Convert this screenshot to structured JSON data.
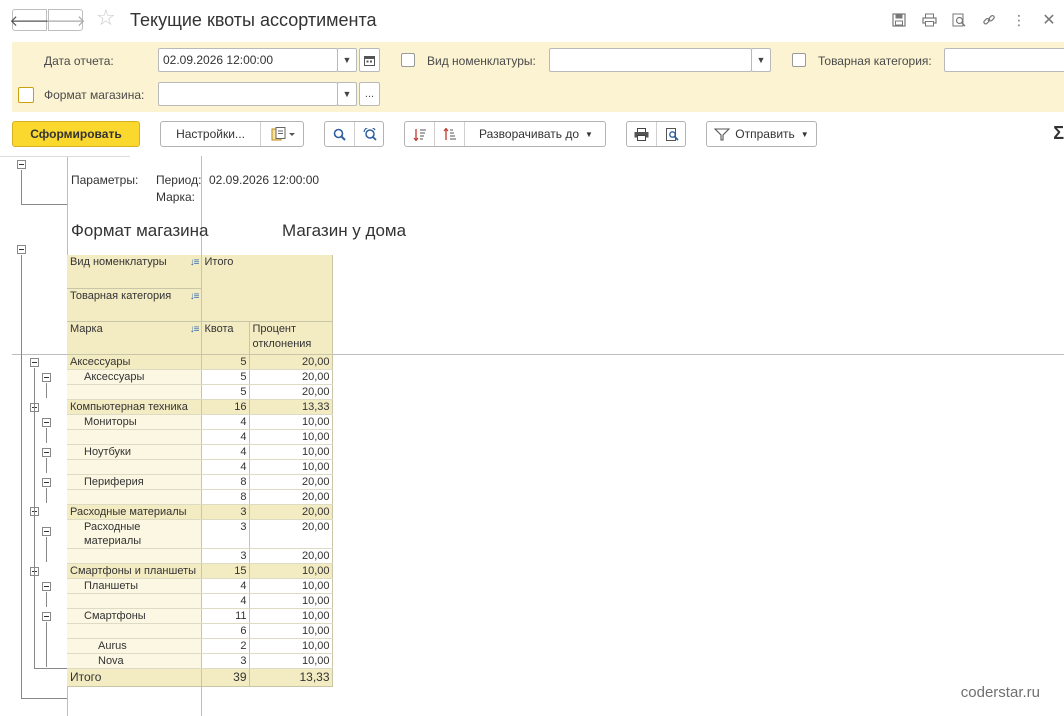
{
  "window": {
    "title": "Текущие квоты ассортимента"
  },
  "filters": {
    "report_date_label": "Дата отчета:",
    "report_date_value": "02.09.2026 12:00:00",
    "nomenclature_type_label": "Вид номенклатуры:",
    "nomenclature_type_value": "",
    "product_category_label": "Товарная категория:",
    "product_category_value": "",
    "store_format_label": "Формат магазина:",
    "store_format_value": ""
  },
  "toolbar": {
    "generate_label": "Сформировать",
    "settings_label": "Настройки...",
    "expand_label": "Разворачивать до",
    "send_label": "Отправить",
    "sigma_label": "Σ"
  },
  "report": {
    "params_label": "Параметры:",
    "period_label": "Период:",
    "period_value": "02.09.2026 12:00:00",
    "brand_param_label": "Марка:",
    "group_label": "Формат магазина",
    "group_value": "Магазин у дома",
    "headers": {
      "nomenclature_type": "Вид номенклатуры",
      "product_category": "Товарная категория",
      "brand": "Марка",
      "total": "Итого",
      "quota": "Квота",
      "deviation": "Процент отклонения"
    },
    "rows": [
      {
        "label": "Аксессуары",
        "level": 0,
        "quota": "5",
        "deviation": "20,00"
      },
      {
        "label": "Аксессуары",
        "level": 1,
        "quota": "5",
        "deviation": "20,00"
      },
      {
        "label": "",
        "level": 2,
        "quota": "5",
        "deviation": "20,00"
      },
      {
        "label": "Компьютерная техника",
        "level": 0,
        "quota": "16",
        "deviation": "13,33"
      },
      {
        "label": "Мониторы",
        "level": 1,
        "quota": "4",
        "deviation": "10,00"
      },
      {
        "label": "",
        "level": 2,
        "quota": "4",
        "deviation": "10,00"
      },
      {
        "label": "Ноутбуки",
        "level": 1,
        "quota": "4",
        "deviation": "10,00"
      },
      {
        "label": "",
        "level": 2,
        "quota": "4",
        "deviation": "10,00"
      },
      {
        "label": "Периферия",
        "level": 1,
        "quota": "8",
        "deviation": "20,00"
      },
      {
        "label": "",
        "level": 2,
        "quota": "8",
        "deviation": "20,00"
      },
      {
        "label": "Расходные материалы",
        "level": 0,
        "quota": "3",
        "deviation": "20,00"
      },
      {
        "label": "Расходные материалы",
        "level": 1,
        "quota": "3",
        "deviation": "20,00"
      },
      {
        "label": "",
        "level": 2,
        "quota": "3",
        "deviation": "20,00"
      },
      {
        "label": "Смартфоны и планшеты",
        "level": 0,
        "quota": "15",
        "deviation": "10,00"
      },
      {
        "label": "Планшеты",
        "level": 1,
        "quota": "4",
        "deviation": "10,00"
      },
      {
        "label": "",
        "level": 2,
        "quota": "4",
        "deviation": "10,00"
      },
      {
        "label": "Смартфоны",
        "level": 1,
        "quota": "11",
        "deviation": "10,00"
      },
      {
        "label": "",
        "level": 2,
        "quota": "6",
        "deviation": "10,00"
      },
      {
        "label": "Aurus",
        "level": 2,
        "quota": "2",
        "deviation": "10,00"
      },
      {
        "label": "Nova",
        "level": 2,
        "quota": "3",
        "deviation": "10,00"
      }
    ],
    "total_row": {
      "label": "Итого",
      "quota": "39",
      "deviation": "13,33"
    }
  },
  "watermark": "coderstar.ru"
}
